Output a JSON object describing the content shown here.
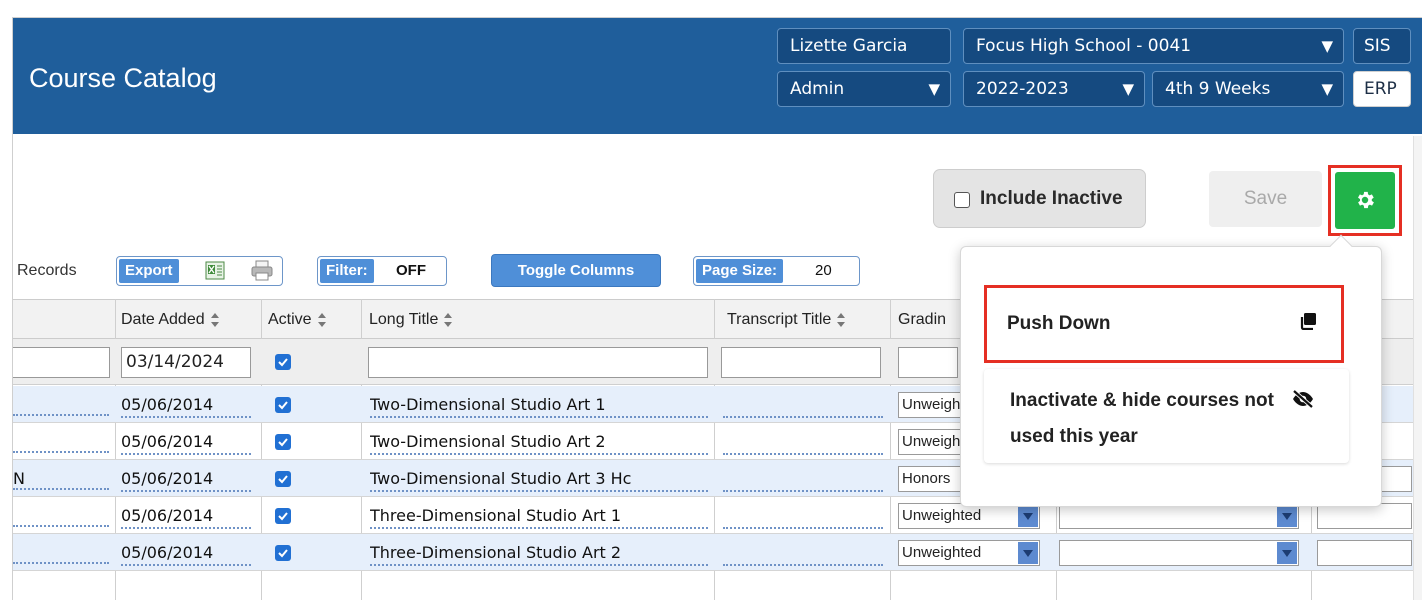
{
  "header": {
    "title": "Course Catalog",
    "user": "Lizette Garcia",
    "role": "Admin",
    "school": "Focus High School - 0041",
    "year": "2022-2023",
    "period": "4th 9 Weeks",
    "module_sis": "SIS",
    "module_erp": "ERP"
  },
  "toolbar": {
    "include_inactive": "Include Inactive",
    "save": "Save",
    "records": "Records",
    "export": "Export",
    "filter_label": "Filter:",
    "filter_value": "OFF",
    "toggle_columns": "Toggle Columns",
    "page_size_label": "Page Size:",
    "page_size_value": "20"
  },
  "table": {
    "columns": [
      "Date Added",
      "Active",
      "Long Title",
      "Transcript Title",
      "Gradin"
    ],
    "filter": {
      "date_added": "03/14/2024"
    },
    "rows": [
      {
        "first": "",
        "date": "05/06/2014",
        "title": "Two-Dimensional Studio Art 1",
        "weight": "Unweighted"
      },
      {
        "first": "",
        "date": "05/06/2014",
        "title": "Two-Dimensional Studio Art 2",
        "weight": "Unweighted"
      },
      {
        "first": "N",
        "date": "05/06/2014",
        "title": "Two-Dimensional Studio Art 3 Hc",
        "weight": "Honors"
      },
      {
        "first": "",
        "date": "05/06/2014",
        "title": "Three-Dimensional Studio Art 1",
        "weight": "Unweighted"
      },
      {
        "first": "",
        "date": "05/06/2014",
        "title": "Three-Dimensional Studio Art 2",
        "weight": "Unweighted"
      }
    ]
  },
  "menu": {
    "push_down": "Push Down",
    "inactivate": "Inactivate & hide courses not used this year"
  },
  "icons": {
    "gear": "gear-icon",
    "copy": "copy-icon",
    "eye_slash": "eye-slash-icon",
    "excel": "excel-icon",
    "print": "print-icon"
  },
  "colors": {
    "header": "#1f5e9b",
    "accent_green": "#21b34a",
    "highlight_red": "#e52f23",
    "button_blue": "#4f8fd8",
    "row_alt": "#e6effb"
  }
}
